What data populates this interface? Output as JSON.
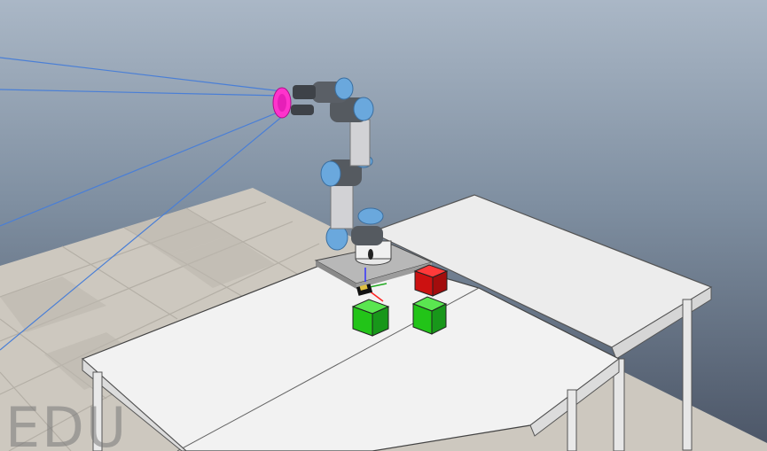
{
  "watermark": {
    "text": "EDU"
  },
  "scene": {
    "sky_top": "#aab7c6",
    "sky_bottom": "#4b5566",
    "floor_tile_light": "#d8d4cc",
    "floor_tile_dark": "#c4bfb6",
    "table_color": "#f2f2f2",
    "robot_link_color": "#cfcfd2",
    "robot_joint_color": "#6aa8dd",
    "sensor_ray_color": "#4a7fd6",
    "camera_marker_color": "#ff33cc",
    "cubes": [
      {
        "name": "red-cube",
        "color": "#dd1111"
      },
      {
        "name": "green-cube-left",
        "color": "#22c418"
      },
      {
        "name": "green-cube-right",
        "color": "#22c418"
      }
    ]
  }
}
